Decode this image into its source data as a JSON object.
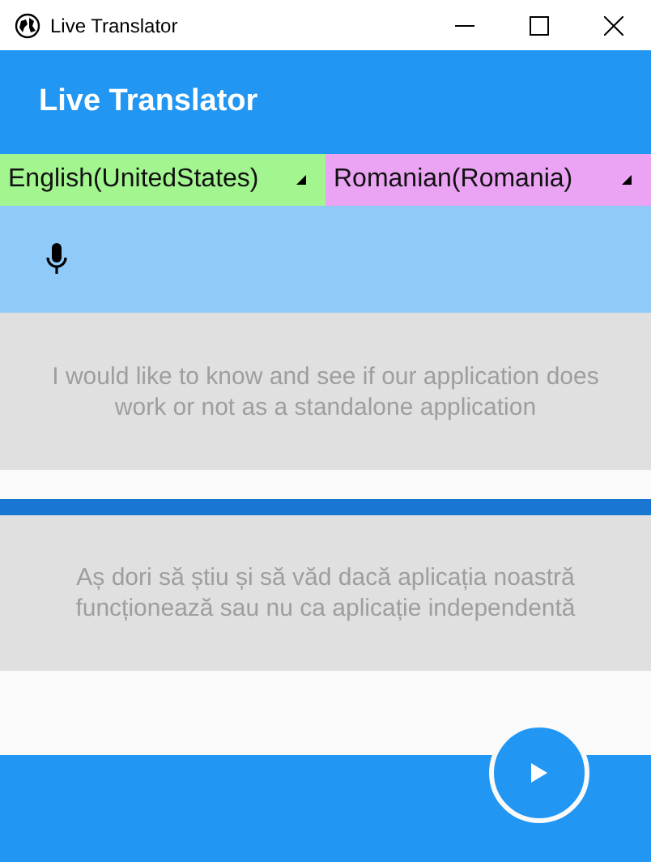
{
  "window": {
    "title": "Live Translator"
  },
  "app_bar": {
    "title": "Live Translator"
  },
  "languages": [
    {
      "label": "English(UnitedStates)",
      "color": "#a2f58f"
    },
    {
      "label": "Romanian(Romania)",
      "color": "#eba3f3"
    }
  ],
  "source_text": "I would like to know and see if our application does work or not as a standalone application",
  "translated_text": "Aș dori să știu și să văd dacă aplicația noastră funcționează sau nu ca aplicație independentă"
}
